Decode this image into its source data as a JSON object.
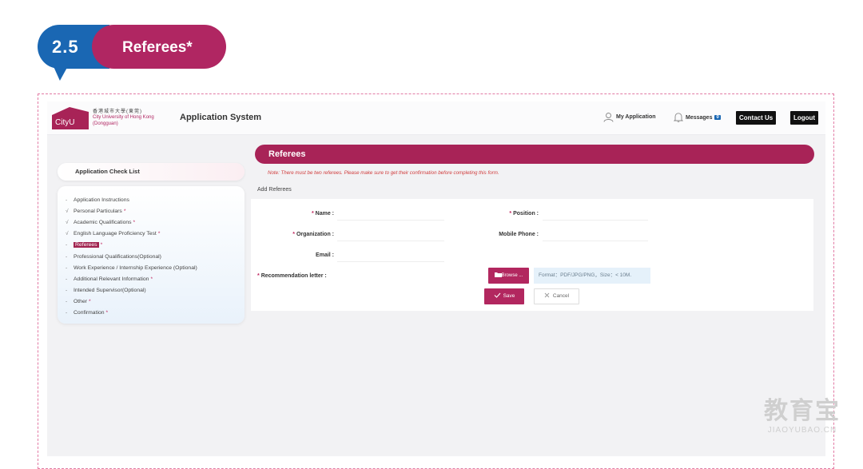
{
  "section_badge": {
    "number": "2.5",
    "title": "Referees*"
  },
  "header": {
    "logo_text": "CityU",
    "logo_cn": "香港城市大學(東莞)",
    "logo_en_line1": "City University of Hong Kong",
    "logo_en_line2": "(Dongguan)",
    "app_title": "Application System",
    "my_application": "My Application",
    "messages": "Messages",
    "messages_count": "0",
    "contact_us": "Contact Us",
    "logout": "Logout"
  },
  "sidebar": {
    "title": "Application Check List",
    "items": [
      {
        "mark": "-",
        "label": "Application Instructions",
        "required": ""
      },
      {
        "mark": "√",
        "label": "Personal Particulars",
        "required": "*"
      },
      {
        "mark": "√",
        "label": "Academic Qualifications",
        "required": "*"
      },
      {
        "mark": "√",
        "label": "English Language Proficiency Test",
        "required": "*"
      },
      {
        "mark": "-",
        "label": "Referees",
        "required": "*"
      },
      {
        "mark": "-",
        "label": "Professional Qualifications(Optional)",
        "required": ""
      },
      {
        "mark": "-",
        "label": "Work Experience / Internship Experience (Optional)",
        "required": ""
      },
      {
        "mark": "-",
        "label": "Additional Relevant Information",
        "required": "*"
      },
      {
        "mark": "-",
        "label": "Intended Supervisor(Optional)",
        "required": ""
      },
      {
        "mark": "-",
        "label": "Other",
        "required": "*"
      },
      {
        "mark": "-",
        "label": "Confirmation",
        "required": "*"
      }
    ]
  },
  "main": {
    "section_title": "Referees",
    "note": "Note: There must be two referees. Please make sure to get their confirmation before completing this form.",
    "add_title": "Add Referees",
    "form": {
      "name_label": "Name :",
      "position_label": "Position :",
      "organization_label": "Organization :",
      "mobile_label": "Mobile Phone :",
      "email_label": "Email :",
      "recommendation_label": "Recommendation letter :",
      "required_mark": "*",
      "browse": "Browse ...",
      "format_hint": "Format：PDF/JPG/PNG，Size：< 10M.",
      "save": "Save",
      "cancel": "Cancel"
    }
  },
  "watermark": {
    "cn": "教育宝",
    "en": "JIAOYUBAO.CN"
  },
  "colors": {
    "brand": "#a82357",
    "blue": "#1a67b3"
  }
}
